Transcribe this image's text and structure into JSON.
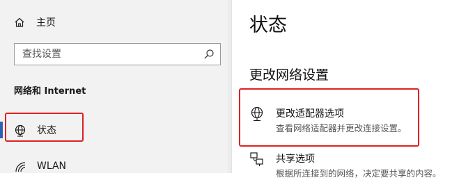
{
  "sidebar": {
    "home_label": "主页",
    "search_placeholder": "查找设置",
    "section_title": "网络和 Internet",
    "items": [
      {
        "label": "状态",
        "icon": "globe-icon",
        "selected": true
      },
      {
        "label": "WLAN",
        "icon": "wifi-icon",
        "selected": false
      }
    ]
  },
  "main": {
    "title": "状态",
    "section_title": "更改网络设置",
    "options": [
      {
        "title": "更改适配器选项",
        "description": "查看网络适配器并更改连接设置。",
        "icon": "network-adapter-icon"
      },
      {
        "title": "共享选项",
        "description": "根据所连接到的网络，决定要共享的内容。",
        "icon": "sharing-icon"
      }
    ]
  },
  "colors": {
    "accent": "#2b63b0",
    "highlight_box": "#e02020",
    "sidebar_bg": "#f2f2f2"
  }
}
